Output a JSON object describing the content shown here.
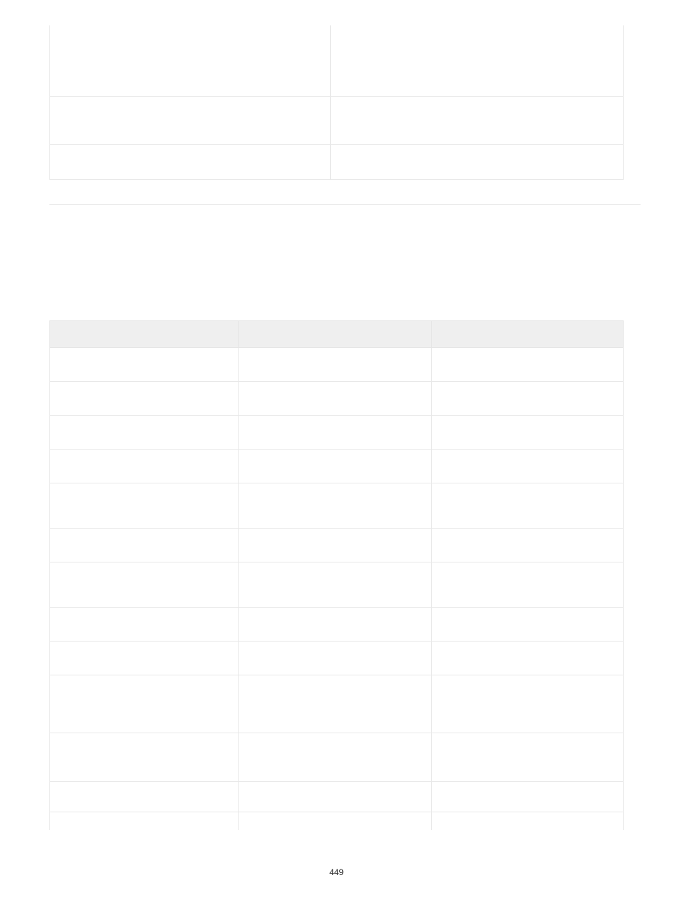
{
  "topTable": {
    "rows": [
      {
        "col1": "",
        "col2": ""
      },
      {
        "col1": "",
        "col2": ""
      },
      {
        "col1": "",
        "col2": ""
      }
    ]
  },
  "bottomTable": {
    "headers": [
      "",
      "",
      ""
    ],
    "rows": [
      {
        "col1": "",
        "col2": "",
        "col3": ""
      },
      {
        "col1": "",
        "col2": "",
        "col3": ""
      },
      {
        "col1": "",
        "col2": "",
        "col3": ""
      },
      {
        "col1": "",
        "col2": "",
        "col3": ""
      },
      {
        "col1": "",
        "col2": "",
        "col3": ""
      },
      {
        "col1": "",
        "col2": "",
        "col3": ""
      },
      {
        "col1": "",
        "col2": "",
        "col3": ""
      },
      {
        "col1": "",
        "col2": "",
        "col3": ""
      },
      {
        "col1": "",
        "col2": "",
        "col3": ""
      },
      {
        "col1": "",
        "col2": "",
        "col3": ""
      },
      {
        "col1": "",
        "col2": "",
        "col3": ""
      },
      {
        "col1": "",
        "col2": "",
        "col3": ""
      },
      {
        "col1": "",
        "col2": "",
        "col3": ""
      }
    ]
  },
  "pageNumber": "449"
}
